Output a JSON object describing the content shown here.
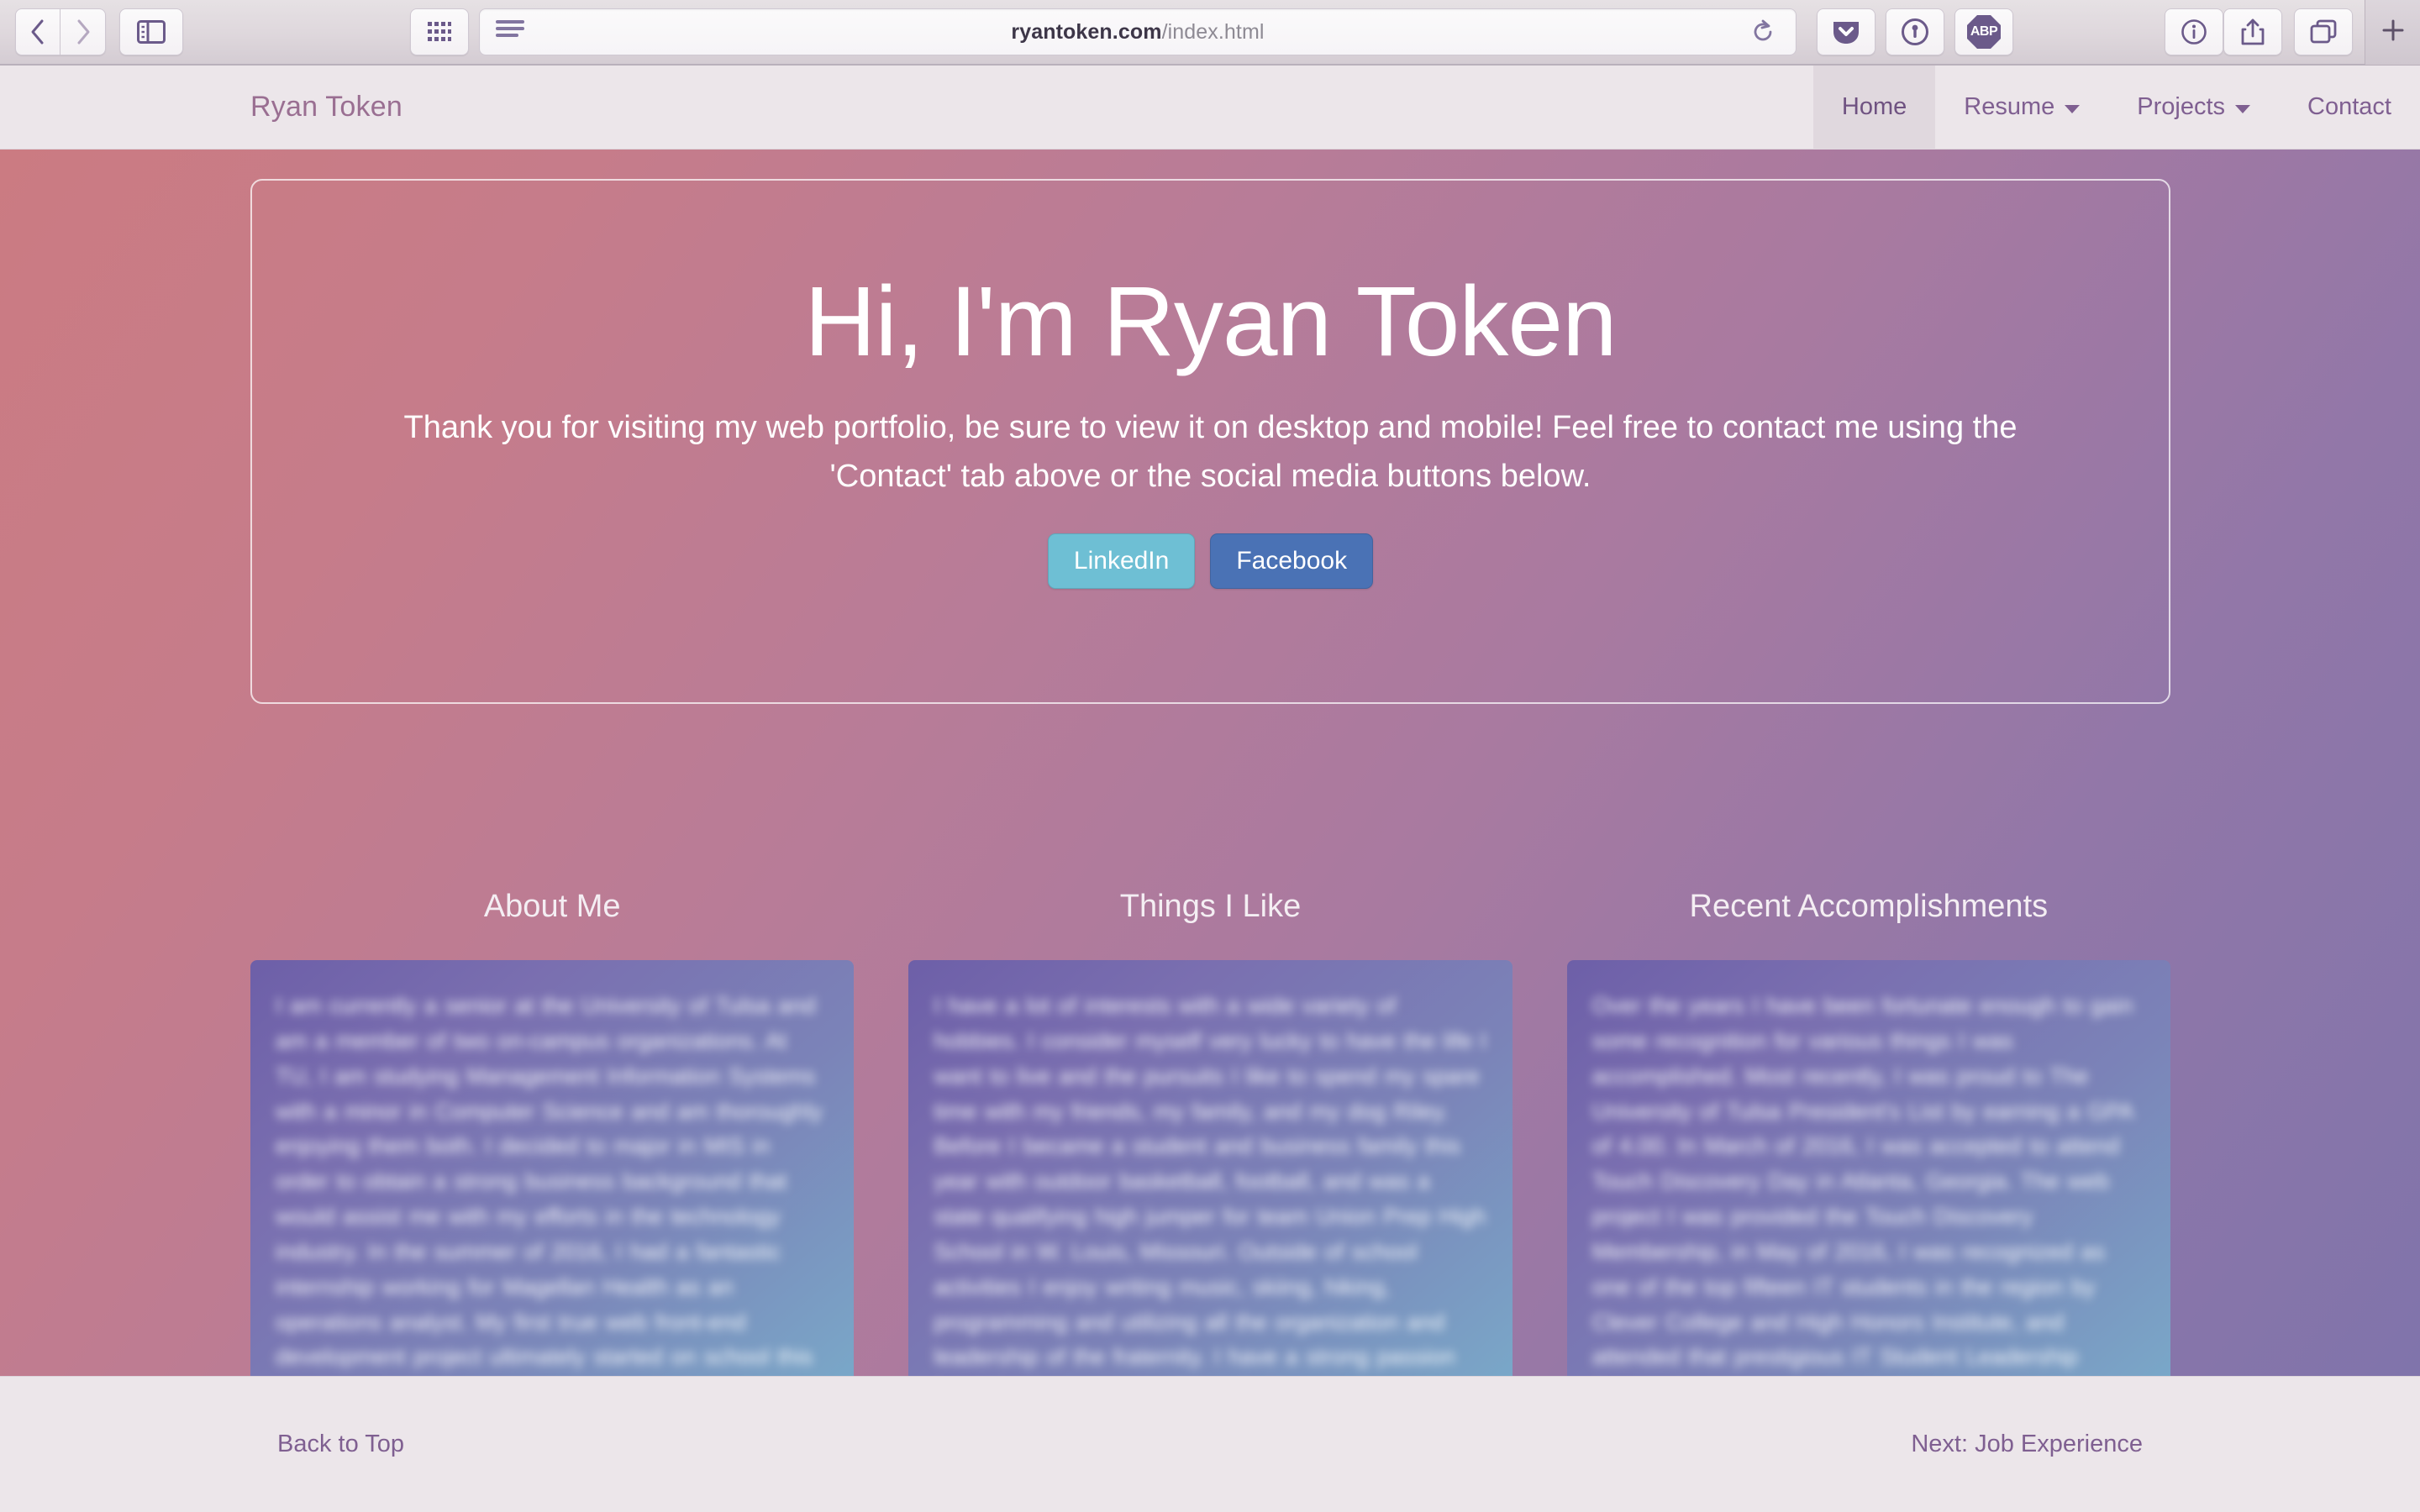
{
  "browser": {
    "url": {
      "host": "ryantoken.com",
      "path": "/index.html"
    },
    "toolbar": {
      "back": "back-icon",
      "forward": "forward-icon",
      "sidebar": "sidebar-icon",
      "tab_overview": "grid-icon",
      "reader": "reader-icon",
      "reload": "reload-icon",
      "pocket": "pocket-icon",
      "onepassword": "1password-icon",
      "adblock_label": "ABP",
      "info": "info-icon",
      "share": "share-icon",
      "tabs": "tabs-icon",
      "new_tab": "plus-icon"
    }
  },
  "site": {
    "brand": "Ryan Token",
    "nav": [
      {
        "label": "Home",
        "active": true,
        "dropdown": false
      },
      {
        "label": "Resume",
        "active": false,
        "dropdown": true
      },
      {
        "label": "Projects",
        "active": false,
        "dropdown": true
      },
      {
        "label": "Contact",
        "active": false,
        "dropdown": false
      }
    ],
    "hero": {
      "title": "Hi, I'm Ryan Token",
      "subtitle": "Thank you for visiting my web portfolio, be sure to view it on desktop and mobile! Feel free to contact me using the 'Contact' tab above or the social media buttons below.",
      "buttons": [
        {
          "label": "LinkedIn",
          "color": "#6ebfd4"
        },
        {
          "label": "Facebook",
          "color": "#4a72b5"
        }
      ]
    },
    "cards": [
      {
        "heading": "About Me",
        "body": "I am currently a senior at the University of Tulsa and am a member of two on-campus organizations. At TU, I am studying Management Information Systems with a minor in Computer Science and am thoroughly enjoying them both. I decided to major in MIS in order to obtain a strong business background that would assist me with my efforts in the technology industry. In the summer of 2016, I had a fantastic internship working for Magellan Health as an operations analyst. My first true web front-end development project ultimately started on school this past year, but I have grown to value both the back-end and business aspects of technology as well."
      },
      {
        "heading": "Things I Like",
        "body": "I have a lot of interests with a wide variety of hobbies. I consider myself very lucky to have the life I want to live and the pursuits I like to spend my spare time with my friends, my family, and my dog Riley. Before I became a student and business family this year with outdoor basketball, football, and was a state qualifying high jumper for team Union Prep High School in W. Louis, Missouri. Outside of school activities I enjoy writing music, skiing, hiking, programming and utilizing all the organization and leadership of the fraternity. I have a strong passion for technology with the Tulsa Golden Hurricane, and all of these have dramatically improved my life."
      },
      {
        "heading": "Recent Accomplishments",
        "body": "Over the years I have been fortunate enough to gain some recognition for various things I was accomplished. Most recently, I was proud to The University of Tulsa President's List by earning a GPA of 4.00. In March of 2016, I was accepted to attend Touch Discovery Day in Atlanta, Georgia. The web project I was provided the Touch Discovery Membership, in May of 2016, I was recognized as one of the top fifteen IT students in the region by Clever College and High Honors Institute, and attended that prestigious IT Student Leadership Forum. Further awards, achievements and positions held can be found on the Resume tab above."
      }
    ],
    "footer": {
      "back_to_top": "Back to Top",
      "next_link": "Next: Job Experience"
    }
  }
}
